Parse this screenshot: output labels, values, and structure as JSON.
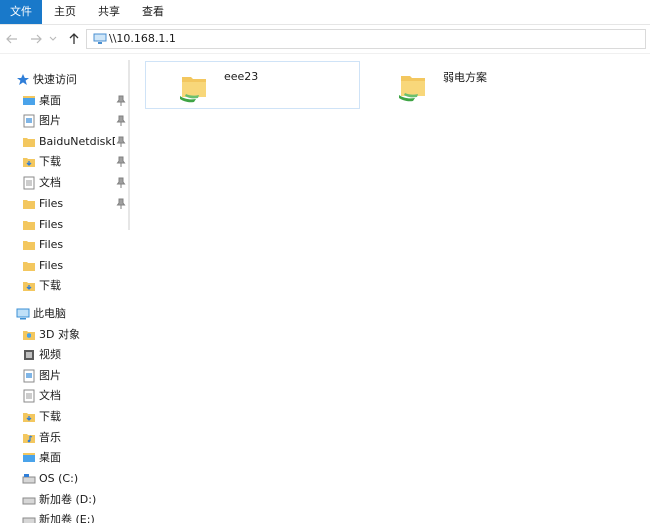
{
  "ribbon": {
    "tabs": [
      {
        "label": "文件",
        "active": true
      },
      {
        "label": "主页",
        "active": false
      },
      {
        "label": "共享",
        "active": false
      },
      {
        "label": "查看",
        "active": false
      }
    ]
  },
  "address": {
    "path": "\\\\10.168.1.1"
  },
  "nav": {
    "quick_access_label": "快速访问",
    "quick_items": [
      {
        "label": "桌面",
        "icon": "desktop-icon",
        "pinned": true
      },
      {
        "label": "图片",
        "icon": "pictures-icon",
        "pinned": true
      },
      {
        "label": "BaiduNetdiskDo",
        "icon": "folder-icon",
        "pinned": true
      },
      {
        "label": "下载",
        "icon": "downloads-icon",
        "pinned": true
      },
      {
        "label": "文档",
        "icon": "documents-icon",
        "pinned": true
      },
      {
        "label": "Files",
        "icon": "folder-icon",
        "pinned": true
      },
      {
        "label": "Files",
        "icon": "folder-icon",
        "pinned": false
      },
      {
        "label": "Files",
        "icon": "folder-icon",
        "pinned": false
      },
      {
        "label": "Files",
        "icon": "folder-icon",
        "pinned": false
      },
      {
        "label": "下载",
        "icon": "downloads-icon",
        "pinned": false
      }
    ],
    "this_pc_label": "此电脑",
    "pc_items": [
      {
        "label": "3D 对象",
        "icon": "3d-objects-icon"
      },
      {
        "label": "视频",
        "icon": "videos-icon"
      },
      {
        "label": "图片",
        "icon": "pictures-icon"
      },
      {
        "label": "文档",
        "icon": "documents-icon"
      },
      {
        "label": "下载",
        "icon": "downloads-icon"
      },
      {
        "label": "音乐",
        "icon": "music-icon"
      },
      {
        "label": "桌面",
        "icon": "desktop-icon"
      },
      {
        "label": "OS (C:)",
        "icon": "drive-icon"
      },
      {
        "label": "新加卷 (D:)",
        "icon": "drive-icon"
      },
      {
        "label": "新加卷 (E:)",
        "icon": "drive-icon"
      }
    ]
  },
  "content": {
    "items": [
      {
        "label": "eee23",
        "icon": "shared-folder-icon",
        "selected": true
      },
      {
        "label": "弱电方案",
        "icon": "shared-folder-icon",
        "selected": false
      }
    ]
  },
  "colors": {
    "accent": "#1979ca",
    "folder": "#f3c75f",
    "share_green": "#3fa445"
  }
}
